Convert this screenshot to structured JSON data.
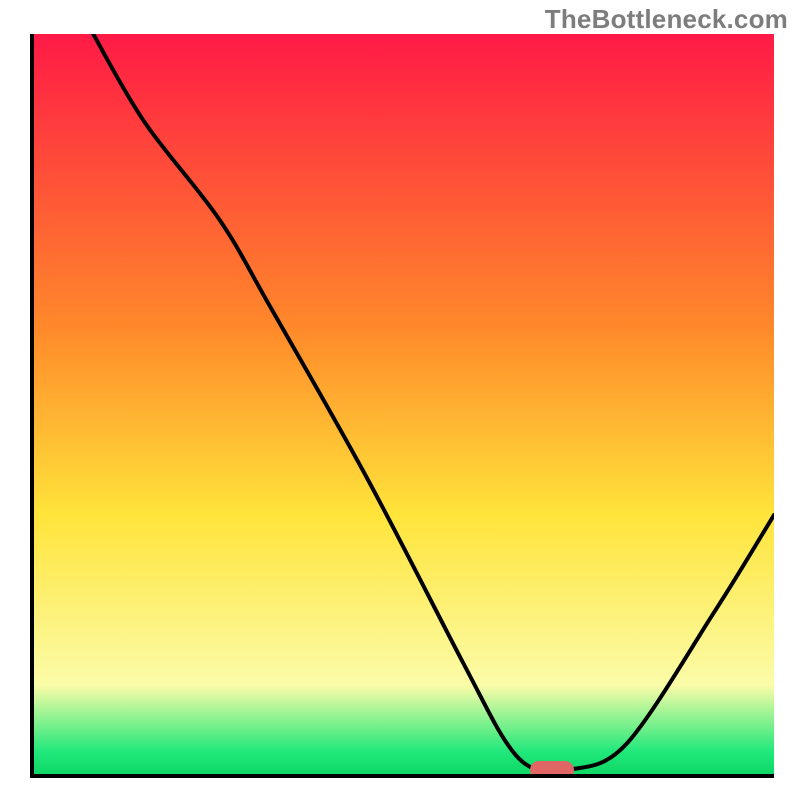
{
  "watermark": "TheBottleneck.com",
  "colors": {
    "red": "#ff1a46",
    "orange": "#ff8a2a",
    "yellow": "#ffe43a",
    "pale_yellow": "#fbfca8",
    "green": "#20e87a",
    "marker": "#e06666",
    "axis": "#000000"
  },
  "chart_data": {
    "type": "line",
    "title": "",
    "xlabel": "",
    "ylabel": "",
    "xlim": [
      0,
      100
    ],
    "ylim": [
      0,
      100
    ],
    "gradient_stops": [
      {
        "offset": 0,
        "color": "#ff1a46"
      },
      {
        "offset": 40,
        "color": "#ff8a2a"
      },
      {
        "offset": 65,
        "color": "#ffe43a"
      },
      {
        "offset": 88,
        "color": "#fbfca8"
      },
      {
        "offset": 97,
        "color": "#20e87a"
      },
      {
        "offset": 100,
        "color": "#0fd867"
      }
    ],
    "series": [
      {
        "name": "bottleneck-curve",
        "x": [
          8,
          15,
          25,
          32,
          45,
          58,
          64,
          68,
          72,
          80,
          92,
          100
        ],
        "y": [
          100,
          88,
          75,
          63,
          40,
          15,
          4,
          0.5,
          0.5,
          4,
          22,
          35
        ]
      }
    ],
    "optimum_marker": {
      "x": 70,
      "y": 0.5,
      "width": 6
    }
  }
}
